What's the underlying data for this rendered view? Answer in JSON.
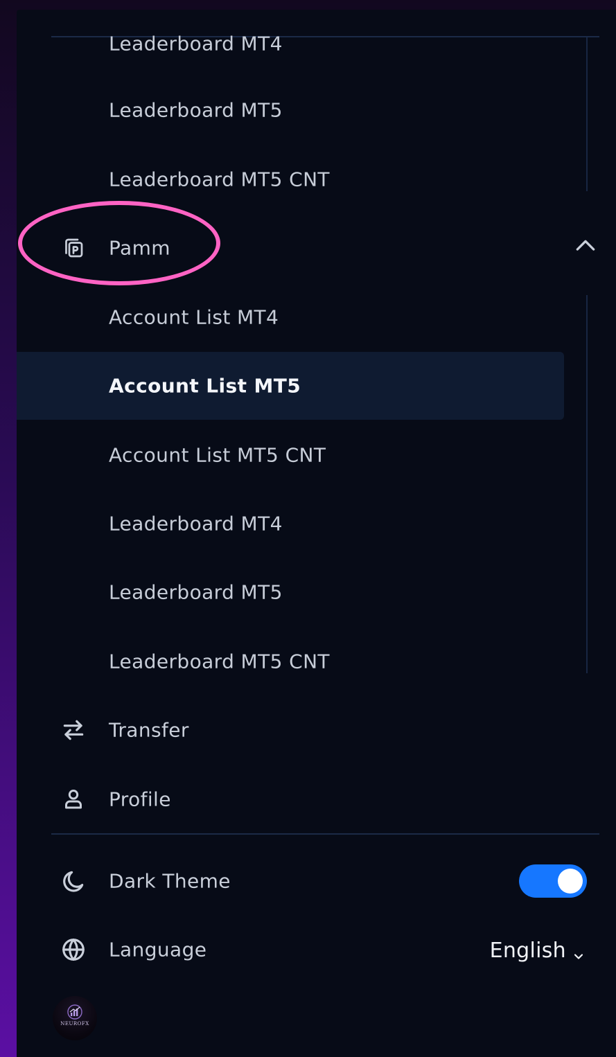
{
  "top_group": {
    "items": [
      {
        "label": "Leaderboard MT4"
      },
      {
        "label": "Leaderboard MT5"
      },
      {
        "label": "Leaderboard MT5 CNT"
      }
    ]
  },
  "pamm": {
    "label": "Pamm",
    "icon": "pamm-icon",
    "expanded": true,
    "items": [
      {
        "label": "Account List MT4"
      },
      {
        "label": "Account List MT5",
        "active": true
      },
      {
        "label": "Account List MT5 CNT"
      },
      {
        "label": "Leaderboard MT4"
      },
      {
        "label": "Leaderboard MT5"
      },
      {
        "label": "Leaderboard MT5 CNT"
      }
    ]
  },
  "nav": {
    "transfer": {
      "label": "Transfer",
      "icon": "transfer-icon"
    },
    "profile": {
      "label": "Profile",
      "icon": "profile-icon"
    }
  },
  "settings": {
    "dark_theme": {
      "label": "Dark Theme",
      "icon": "moon-icon",
      "enabled": true
    },
    "language": {
      "label": "Language",
      "icon": "globe-icon",
      "value": "English"
    }
  },
  "logo": {
    "text": "NEUROFX"
  },
  "colors": {
    "panel_bg": "#070b17",
    "active_item_bg": "#0f1b31",
    "toggle_on": "#1677ff",
    "highlight_ring": "#ff63c4",
    "side_gradient_bottom": "#5b0fa3"
  }
}
